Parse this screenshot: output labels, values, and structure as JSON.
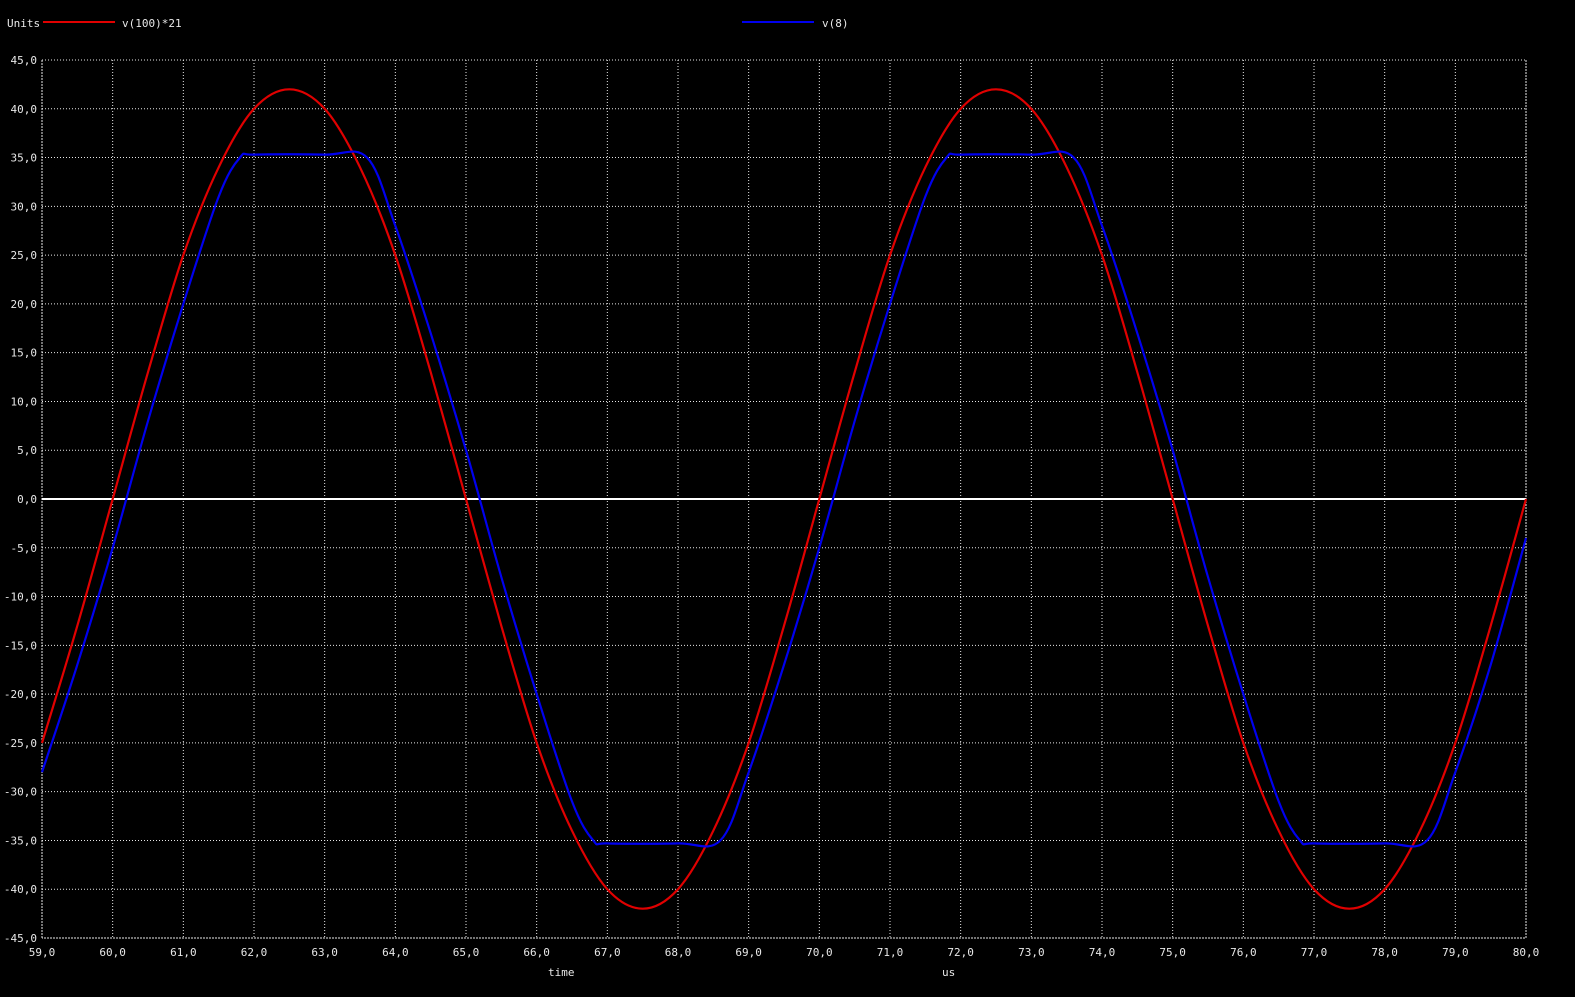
{
  "chart_data": {
    "type": "line",
    "ylabel": "Units",
    "xlabel": "time",
    "xunit": "us",
    "xlim": [
      59.0,
      80.0
    ],
    "ylim": [
      -45.0,
      45.0
    ],
    "x_ticks": [
      "59,0",
      "60,0",
      "61,0",
      "62,0",
      "63,0",
      "64,0",
      "65,0",
      "66,0",
      "67,0",
      "68,0",
      "69,0",
      "70,0",
      "71,0",
      "72,0",
      "73,0",
      "74,0",
      "75,0",
      "76,0",
      "77,0",
      "78,0",
      "79,0",
      "80,0"
    ],
    "y_ticks": [
      "45,0",
      "40,0",
      "35,0",
      "30,0",
      "25,0",
      "20,0",
      "15,0",
      "10,0",
      "5,0",
      "0,0",
      "-5,0",
      "-10,0",
      "-15,0",
      "-20,0",
      "-25,0",
      "-30,0",
      "-35,0",
      "-40,0",
      "-45,0"
    ],
    "grid": true,
    "legend_position": "top",
    "colors": {
      "background": "#000000",
      "grid": "#e8e8e8",
      "zero_line": "#ffffff",
      "v100": "#e00000",
      "v8": "#0000ee"
    },
    "series": [
      {
        "name": "v(100)*21",
        "color": "#e00000",
        "x": [
          59.0,
          59.5,
          60.0,
          60.5,
          61.0,
          61.5,
          62.0,
          62.5,
          63.0,
          63.5,
          64.0,
          64.5,
          65.0,
          65.5,
          66.0,
          66.5,
          67.0,
          67.5,
          68.0,
          68.5,
          69.0,
          69.5,
          70.0,
          70.5,
          71.0,
          71.5,
          72.0,
          72.5,
          73.0,
          73.5,
          74.0,
          74.5,
          75.0,
          75.5,
          76.0,
          76.5,
          77.0,
          77.5,
          78.0,
          78.5,
          79.0,
          79.5,
          80.0
        ],
        "y": [
          -25.0,
          -13.0,
          0.0,
          13.0,
          25.0,
          34.0,
          40.0,
          42.0,
          40.0,
          34.0,
          25.0,
          13.0,
          0.0,
          -13.0,
          -25.0,
          -34.0,
          -40.0,
          -42.0,
          -40.0,
          -34.0,
          -25.0,
          -13.0,
          0.0,
          13.0,
          25.0,
          34.0,
          40.0,
          42.0,
          40.0,
          34.0,
          25.0,
          13.0,
          0.0,
          -13.0,
          -25.0,
          -34.0,
          -40.0,
          -42.0,
          -40.0,
          -34.0,
          -25.0,
          -13.0,
          0.0
        ]
      },
      {
        "name": "v(8)",
        "color": "#0000ee",
        "x": [
          59.0,
          59.5,
          60.0,
          60.5,
          61.0,
          61.5,
          61.8,
          62.0,
          63.0,
          63.6,
          64.0,
          64.5,
          65.0,
          65.5,
          66.0,
          66.5,
          66.8,
          67.0,
          68.0,
          68.6,
          69.0,
          69.5,
          70.0,
          70.5,
          71.0,
          71.5,
          71.8,
          72.0,
          73.0,
          73.6,
          74.0,
          74.5,
          75.0,
          75.5,
          76.0,
          76.5,
          76.8,
          77.0,
          78.0,
          78.6,
          79.0,
          79.5,
          80.0
        ],
        "y": [
          -28.0,
          -17.0,
          -5.0,
          8.0,
          20.0,
          31.0,
          35.0,
          35.3,
          35.3,
          35.0,
          28.0,
          17.0,
          5.0,
          -8.0,
          -20.0,
          -31.0,
          -35.0,
          -35.3,
          -35.3,
          -35.0,
          -28.0,
          -17.0,
          -5.0,
          8.0,
          20.0,
          31.0,
          35.0,
          35.3,
          35.3,
          35.0,
          28.0,
          17.0,
          5.0,
          -8.0,
          -20.0,
          -31.0,
          -35.0,
          -35.3,
          -35.3,
          -35.0,
          -28.0,
          -17.0,
          -4.0
        ]
      }
    ]
  }
}
